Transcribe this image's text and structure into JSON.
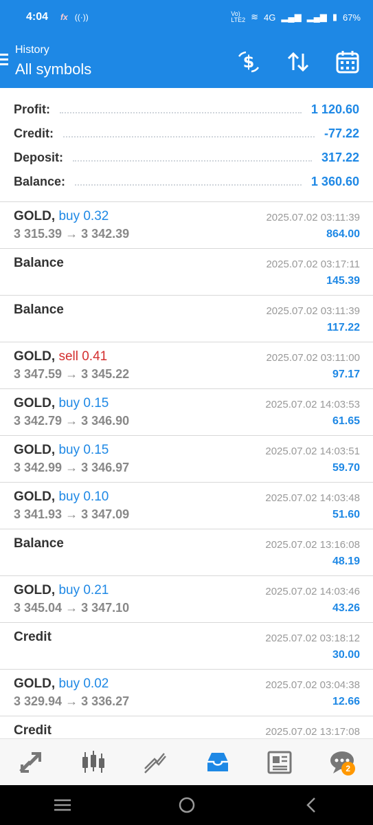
{
  "status_bar": {
    "time": "4:04",
    "battery": "67%",
    "network": "4G"
  },
  "app_bar": {
    "subtitle": "History",
    "title": "All symbols"
  },
  "summary": [
    {
      "label": "Profit:",
      "value": "1 120.60"
    },
    {
      "label": "Credit:",
      "value": "-77.22"
    },
    {
      "label": "Deposit:",
      "value": "317.22"
    },
    {
      "label": "Balance:",
      "value": "1 360.60"
    }
  ],
  "items": [
    {
      "symbol": "GOLD,",
      "side": "buy 0.32",
      "side_type": "buy",
      "prices": "3 315.39 → 3 342.39",
      "time": "2025.07.02 03:11:39",
      "profit": "864.00"
    },
    {
      "symbol": "Balance",
      "side": "",
      "side_type": "",
      "prices": "",
      "time": "2025.07.02 03:17:11",
      "profit": "145.39"
    },
    {
      "symbol": "Balance",
      "side": "",
      "side_type": "",
      "prices": "",
      "time": "2025.07.02 03:11:39",
      "profit": "117.22"
    },
    {
      "symbol": "GOLD,",
      "side": "sell 0.41",
      "side_type": "sell",
      "prices": "3 347.59 → 3 345.22",
      "time": "2025.07.02 03:11:00",
      "profit": "97.17"
    },
    {
      "symbol": "GOLD,",
      "side": "buy 0.15",
      "side_type": "buy",
      "prices": "3 342.79 → 3 346.90",
      "time": "2025.07.02 14:03:53",
      "profit": "61.65"
    },
    {
      "symbol": "GOLD,",
      "side": "buy 0.15",
      "side_type": "buy",
      "prices": "3 342.99 → 3 346.97",
      "time": "2025.07.02 14:03:51",
      "profit": "59.70"
    },
    {
      "symbol": "GOLD,",
      "side": "buy 0.10",
      "side_type": "buy",
      "prices": "3 341.93 → 3 347.09",
      "time": "2025.07.02 14:03:48",
      "profit": "51.60"
    },
    {
      "symbol": "Balance",
      "side": "",
      "side_type": "",
      "prices": "",
      "time": "2025.07.02 13:16:08",
      "profit": "48.19"
    },
    {
      "symbol": "GOLD,",
      "side": "buy 0.21",
      "side_type": "buy",
      "prices": "3 345.04 → 3 347.10",
      "time": "2025.07.02 14:03:46",
      "profit": "43.26"
    },
    {
      "symbol": "Credit",
      "side": "",
      "side_type": "",
      "prices": "",
      "time": "2025.07.02 03:18:12",
      "profit": "30.00"
    },
    {
      "symbol": "GOLD,",
      "side": "buy 0.02",
      "side_type": "buy",
      "prices": "3 329.94 → 3 336.27",
      "time": "2025.07.02 03:04:38",
      "profit": "12.66"
    },
    {
      "symbol": "Credit",
      "side": "",
      "side_type": "",
      "prices": "",
      "time": "2025.07.02 13:17:08",
      "profit": ""
    }
  ],
  "bottom_nav": [
    {
      "icon": "quotes-icon"
    },
    {
      "icon": "chart-icon"
    },
    {
      "icon": "trade-icon"
    },
    {
      "icon": "history-icon",
      "active": true
    },
    {
      "icon": "news-icon"
    },
    {
      "icon": "messages-icon",
      "badge": "2"
    }
  ],
  "colors": {
    "accent": "#1e88e5",
    "sell": "#d32f2f",
    "badge": "#ff9800"
  }
}
